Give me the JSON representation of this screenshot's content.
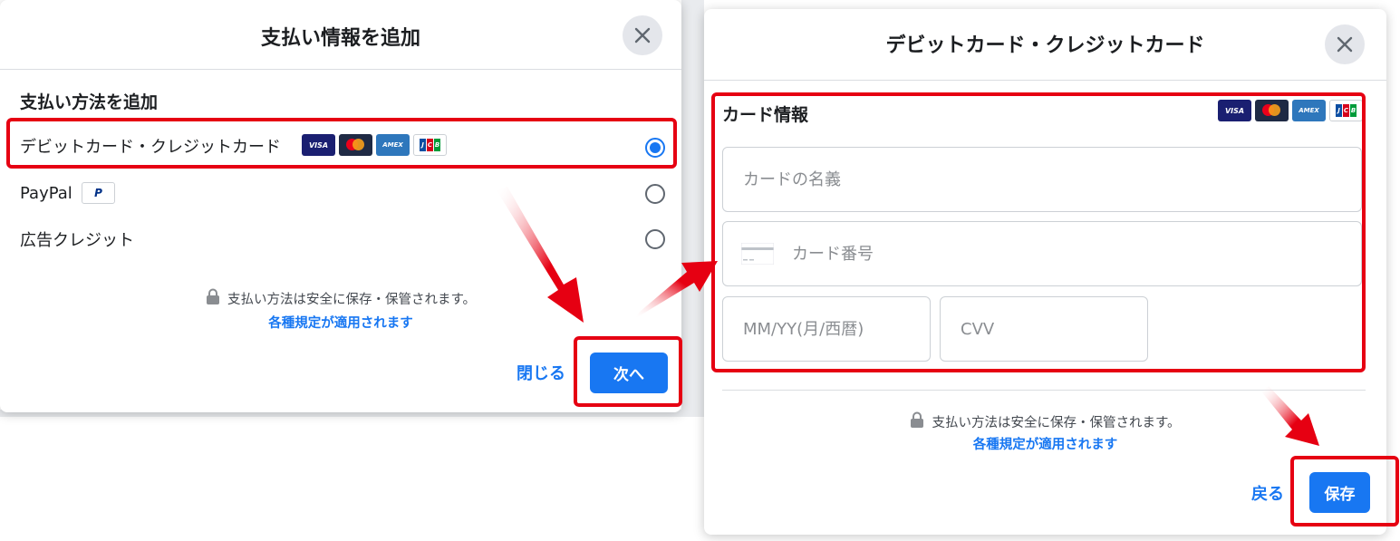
{
  "dialog1": {
    "title": "支払い情報を追加",
    "section_title": "支払い方法を追加",
    "options": [
      {
        "label": "デビットカード・クレジットカード",
        "selected": true,
        "logos": [
          "VISA",
          "mastercard",
          "AMEX",
          "JCB"
        ]
      },
      {
        "label": "PayPal",
        "selected": false,
        "logo": "P"
      },
      {
        "label": "広告クレジット",
        "selected": false
      }
    ],
    "secure_text": "支払い方法は安全に保存・保管されます。",
    "policy_link": "各種規定が適用されます",
    "close_label": "閉じる",
    "next_label": "次へ"
  },
  "dialog2": {
    "title": "デビットカード・クレジットカード",
    "section_title": "カード情報",
    "logos": [
      "VISA",
      "mastercard",
      "AMEX",
      "JCB"
    ],
    "fields": {
      "name_placeholder": "カードの名義",
      "number_placeholder": "カード番号",
      "expiry_placeholder": "MM/YY(月/西暦)",
      "cvv_placeholder": "CVV"
    },
    "secure_text": "支払い方法は安全に保存・保管されます。",
    "policy_link": "各種規定が適用されます",
    "back_label": "戻る",
    "save_label": "保存"
  },
  "colors": {
    "accent": "#1877f2",
    "highlight": "#e60012"
  }
}
